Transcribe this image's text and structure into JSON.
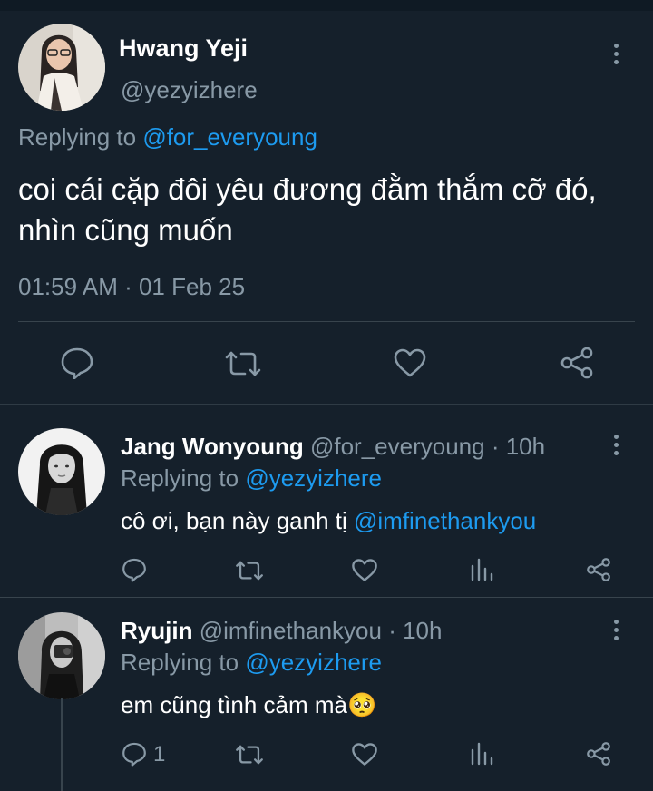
{
  "main_tweet": {
    "author_name": "Hwang Yeji",
    "handle": "@yezyizhere",
    "replying_prefix": "Replying to",
    "replying_to": "@for_everyoung",
    "text": "coi cái cặp đôi yêu đương đằm thắm cỡ đó, nhìn cũng muốn",
    "timestamp": "01:59 AM · 01 Feb 25",
    "actions": [
      "reply-icon",
      "retweet-icon",
      "like-icon",
      "share-icon"
    ]
  },
  "replies": [
    {
      "author_name": "Jang Wonyoung",
      "handle": "@for_everyoung",
      "time": "· 10h",
      "replying_prefix": "Replying to",
      "replying_to": "@yezyizhere",
      "text": "cô ơi, bạn này ganh tị ",
      "mention": "@imfinethankyou",
      "reply_count": ""
    },
    {
      "author_name": "Ryujin",
      "handle": "@imfinethankyou",
      "time": "· 10h",
      "replying_prefix": "Replying to",
      "replying_to": "@yezyizhere",
      "text": "em cũng tình cảm mà",
      "emoji": "🥺",
      "reply_count": "1"
    }
  ],
  "colors": {
    "background": "#15202b",
    "text_primary": "#ffffff",
    "text_secondary": "#8899a6",
    "accent": "#1d9bf0",
    "divider": "#38444d"
  }
}
